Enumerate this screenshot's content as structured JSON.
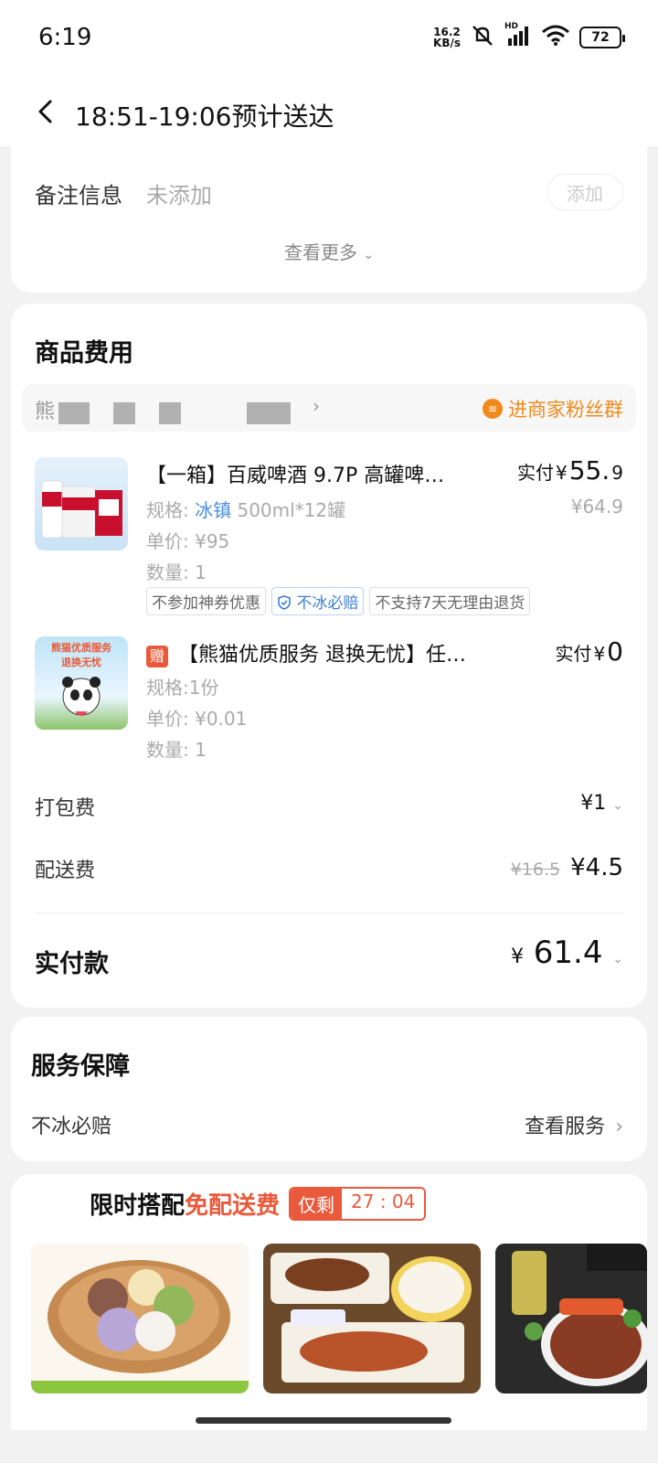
{
  "status_bar": {
    "time": "6:19",
    "speed_value": "16.2",
    "speed_unit": "KB/s",
    "battery": "72",
    "network": "HD"
  },
  "header": {
    "title": "18:51-19:06预计送达"
  },
  "note": {
    "label": "备注信息",
    "value": "未添加",
    "add_label": "添加",
    "see_more": "查看更多"
  },
  "goods": {
    "section_title": "商品费用",
    "store_name": "熊",
    "fans_group": "进商家粉丝群",
    "items": [
      {
        "title": "【一箱】百威啤酒 9.7P 高罐啤…",
        "paid_prefix": "实付",
        "paid_currency": "¥",
        "paid_int": "55.",
        "paid_dec": "9",
        "original_price": "¥64.9",
        "spec_label": "规格:",
        "spec_highlight": "冰镇",
        "spec_value": "500ml*12罐",
        "unit_price": "单价: ¥95",
        "quantity": "数量: 1",
        "tags": [
          "不参加神券优惠",
          "不冰必赔",
          "不支持7天无理由退货"
        ]
      },
      {
        "gift_badge": "赠",
        "title": "【熊猫优质服务 退换无忧】任…",
        "paid_prefix": "实付",
        "paid_currency": "¥",
        "paid_int": "0",
        "spec": "规格:1份",
        "unit_price": "单价: ¥0.01",
        "quantity": "数量: 1",
        "thumb_caption_1": "熊猫优质服务",
        "thumb_caption_2": "退换无忧"
      }
    ],
    "packing_fee_label": "打包费",
    "packing_fee": "¥1",
    "delivery_fee_label": "配送费",
    "delivery_fee_original": "¥16.5",
    "delivery_fee": "¥4.5",
    "total_label": "实付款",
    "total_currency": "¥",
    "total_value": "61.4"
  },
  "service": {
    "title": "服务保障",
    "item": "不冰必赔",
    "link": "查看服务"
  },
  "promo": {
    "title": "限时搭配",
    "title_red": "免配送费",
    "countdown_label": "仅剩",
    "countdown_time": "27 : 04",
    "images": [
      "mochi-dessert",
      "roast-duck-set",
      "steak-drink"
    ]
  },
  "colors": {
    "accent_orange": "#f08a1c",
    "accent_red": "#e95a3c",
    "link_blue": "#4a8fe2"
  }
}
